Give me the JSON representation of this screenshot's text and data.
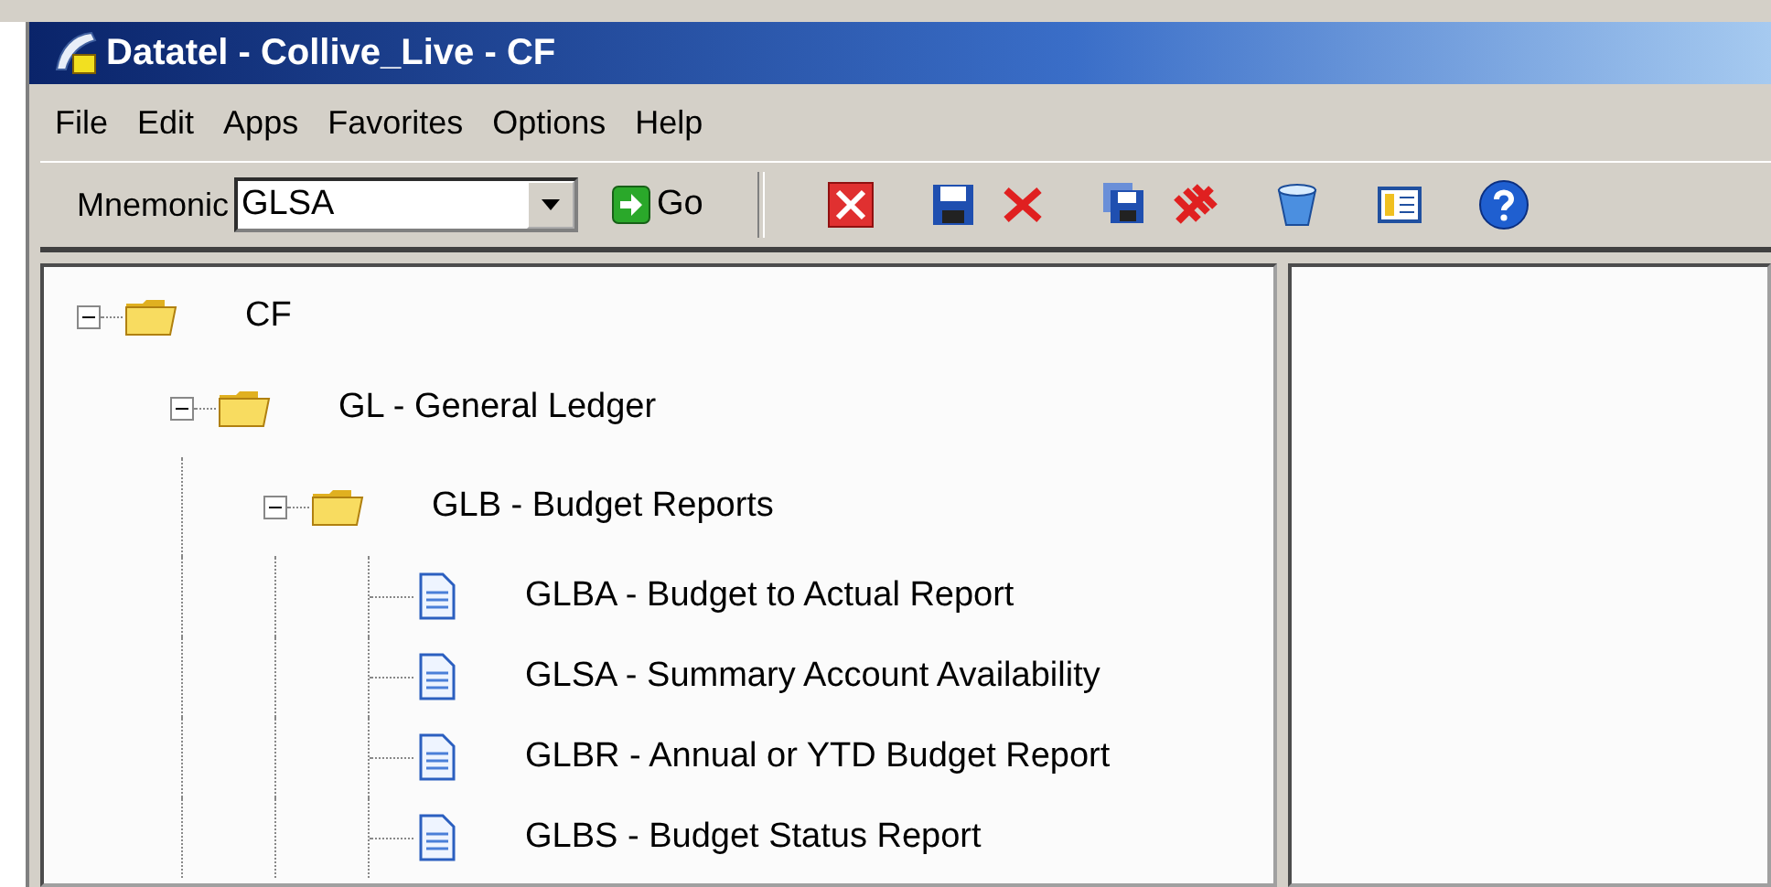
{
  "window": {
    "title": "Datatel - Collive_Live - CF"
  },
  "menu": [
    "File",
    "Edit",
    "Apps",
    "Favorites",
    "Options",
    "Help"
  ],
  "toolbar": {
    "mnemonic_label": "Mnemonic",
    "mnemonic_value": "GLSA",
    "go_label": "Go"
  },
  "tree": [
    {
      "label": "CF",
      "kind": "folder",
      "expanded": true,
      "children": [
        {
          "label": "GL - General Ledger",
          "kind": "folder",
          "expanded": true,
          "children": [
            {
              "label": "GLB - Budget Reports",
              "kind": "folder",
              "expanded": true,
              "children": [
                {
                  "label": "GLBA - Budget to Actual Report",
                  "kind": "document"
                },
                {
                  "label": "GLSA - Summary Account Availability",
                  "kind": "document"
                },
                {
                  "label": "GLBR - Annual or YTD Budget Report",
                  "kind": "document"
                },
                {
                  "label": "GLBS - Budget Status Report",
                  "kind": "document"
                }
              ]
            }
          ]
        }
      ]
    }
  ]
}
